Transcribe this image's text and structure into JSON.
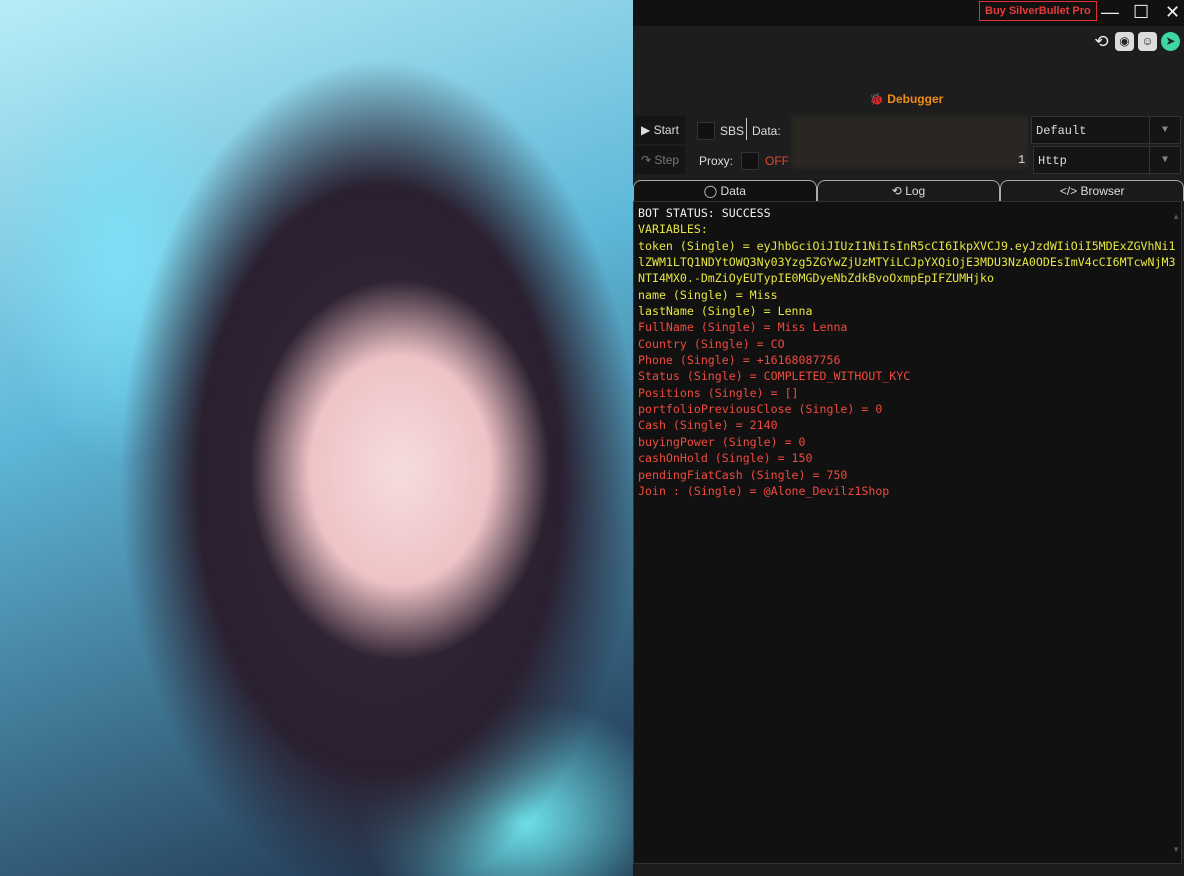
{
  "header": {
    "buy_label": "Buy SilverBullet Pro",
    "minimize": "—",
    "maximize": "☐",
    "close": "✕"
  },
  "toolbar_icons": [
    "history-icon",
    "camera-icon",
    "discord-icon",
    "telegram-icon"
  ],
  "debugger": {
    "title": "Debugger",
    "start_label": "Start",
    "step_label": "Step",
    "sbs_label": "SBS",
    "data_label": "Data:",
    "proxy_label": "Proxy:",
    "proxy_state": "OFF",
    "data_value_tail": "1",
    "wordlist_type": "Default",
    "proxy_type": "Http"
  },
  "tabs": [
    {
      "label": "Data"
    },
    {
      "label": "Log"
    },
    {
      "label": "Browser"
    }
  ],
  "output": [
    {
      "text": "BOT STATUS: SUCCESS",
      "color": "w"
    },
    {
      "text": "VARIABLES:",
      "color": "y"
    },
    {
      "text": "token (Single) = eyJhbGciOiJIUzI1NiIsInR5cCI6IkpXVCJ9.eyJzdWIiOiI5MDExZGVhNi1lZWM1LTQ1NDYtOWQ3Ny03Yzg5ZGYwZjUzMTYiLCJpYXQiOjE3MDU3NzA0ODEsImV4cCI6MTcwNjM3NTI4MX0.-DmZiOyEUTypIE0MGDyeNbZdkBvoOxmpEpIFZUMHjko",
      "color": "y"
    },
    {
      "text": "name (Single) = Miss",
      "color": "y"
    },
    {
      "text": "lastName (Single) = Lenna",
      "color": "y"
    },
    {
      "text": "FullName (Single) = Miss Lenna",
      "color": "r"
    },
    {
      "text": "Country (Single) = CO",
      "color": "r"
    },
    {
      "text": "Phone (Single) = +16168087756",
      "color": "r"
    },
    {
      "text": "Status (Single) = COMPLETED_WITHOUT_KYC",
      "color": "r"
    },
    {
      "text": "Positions (Single) = []",
      "color": "r"
    },
    {
      "text": "portfolioPreviousClose (Single) = 0",
      "color": "r"
    },
    {
      "text": "Cash (Single) = 2140",
      "color": "r"
    },
    {
      "text": "buyingPower (Single) = 0",
      "color": "r"
    },
    {
      "text": "cashOnHold (Single) = 150",
      "color": "r"
    },
    {
      "text": "pendingFiatCash (Single) = 750",
      "color": "r"
    },
    {
      "text": "Join : (Single) = @Alone_Devilz1Shop",
      "color": "r"
    }
  ]
}
